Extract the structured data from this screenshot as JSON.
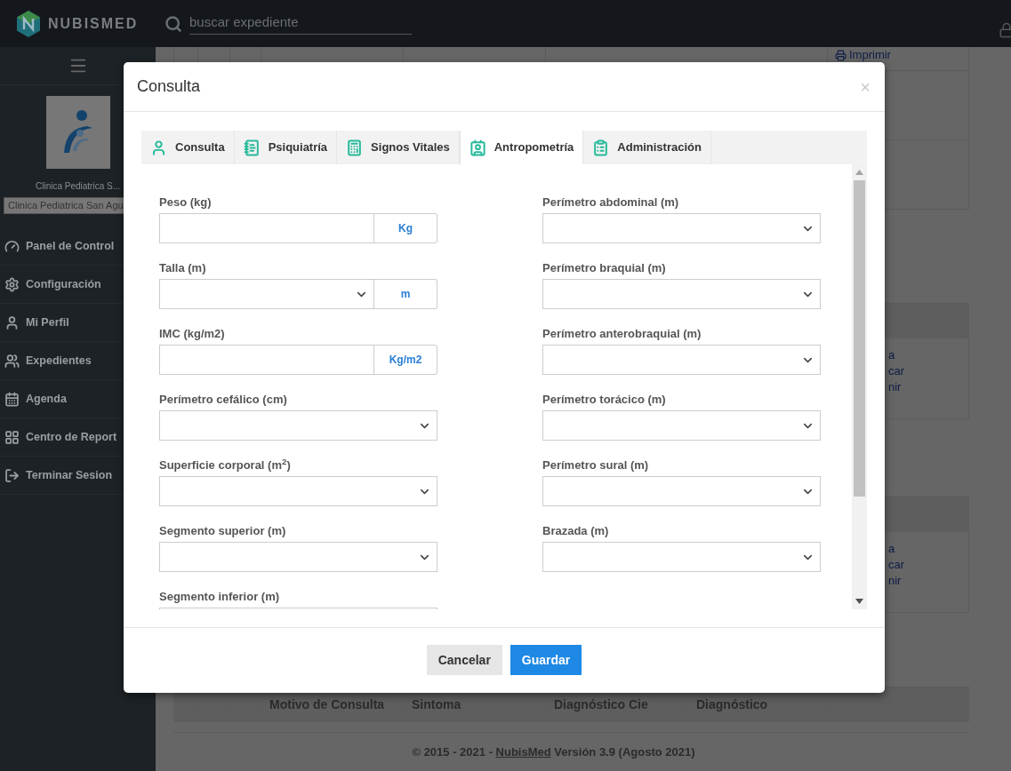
{
  "header": {
    "brand": "NUBISMED",
    "search": {
      "placeholder": "buscar expediente"
    }
  },
  "sidebar": {
    "clinic_name": "Clinica Pediatrica S...",
    "clinic_select": "Clinica Pediatrica San Agu",
    "items": [
      {
        "label": "Panel de Control"
      },
      {
        "label": "Configuración"
      },
      {
        "label": "Mi Perfil"
      },
      {
        "label": "Expedientes"
      },
      {
        "label": "Agenda"
      },
      {
        "label": "Centro de Report"
      },
      {
        "label": "Terminar Sesion"
      }
    ]
  },
  "background": {
    "top_link": "Imprimir",
    "cards": [
      {
        "links": [
          "a",
          "car",
          "nir"
        ]
      },
      {
        "links": [
          "a",
          "car",
          "nir"
        ]
      }
    ],
    "table_columns": [
      "Motivo de Consulta",
      "Sintoma",
      "Diagnóstico Cie",
      "Diagnóstico"
    ]
  },
  "footer": {
    "text_before": "© 2015 - 2021 - ",
    "link": "NubisMed",
    "text_after": " Versión 3.9 (Agosto 2021)"
  },
  "modal": {
    "title": "Consulta",
    "close": "×",
    "tabs": [
      {
        "label": "Consulta",
        "selected": false
      },
      {
        "label": "Psiquiatría",
        "selected": false
      },
      {
        "label": "Signos Vitales",
        "selected": false
      },
      {
        "label": "Antropometría",
        "selected": true
      },
      {
        "label": "Administración",
        "selected": false
      }
    ],
    "left_fields": [
      {
        "label": "Peso (kg)",
        "kind": "input_addon",
        "addon": "Kg"
      },
      {
        "label": "Talla (m)",
        "kind": "select_addon",
        "addon": "m"
      },
      {
        "label": "IMC (kg/m2)",
        "kind": "input_addon",
        "addon": "Kg/m2"
      },
      {
        "label": "Perímetro cefálico (cm)",
        "kind": "select"
      },
      {
        "label": "Superficie corporal (m$^{2}$)",
        "kind": "select"
      },
      {
        "label": "Segmento superior (m)",
        "kind": "select"
      },
      {
        "label": "Segmento inferior (m)",
        "kind": "select"
      }
    ],
    "right_fields": [
      {
        "label": "Perímetro abdominal (m)",
        "kind": "select"
      },
      {
        "label": "Perímetro braquial (m)",
        "kind": "select"
      },
      {
        "label": "Perímetro anterobraquial (m)",
        "kind": "select"
      },
      {
        "label": "Perímetro torácico (m)",
        "kind": "select"
      },
      {
        "label": "Perímetro sural (m)",
        "kind": "select"
      },
      {
        "label": "Brazada (m)",
        "kind": "select"
      }
    ],
    "buttons": [
      {
        "label": "Cancelar",
        "kind": "secondary"
      },
      {
        "label": "Guardar",
        "kind": "primary"
      }
    ]
  }
}
